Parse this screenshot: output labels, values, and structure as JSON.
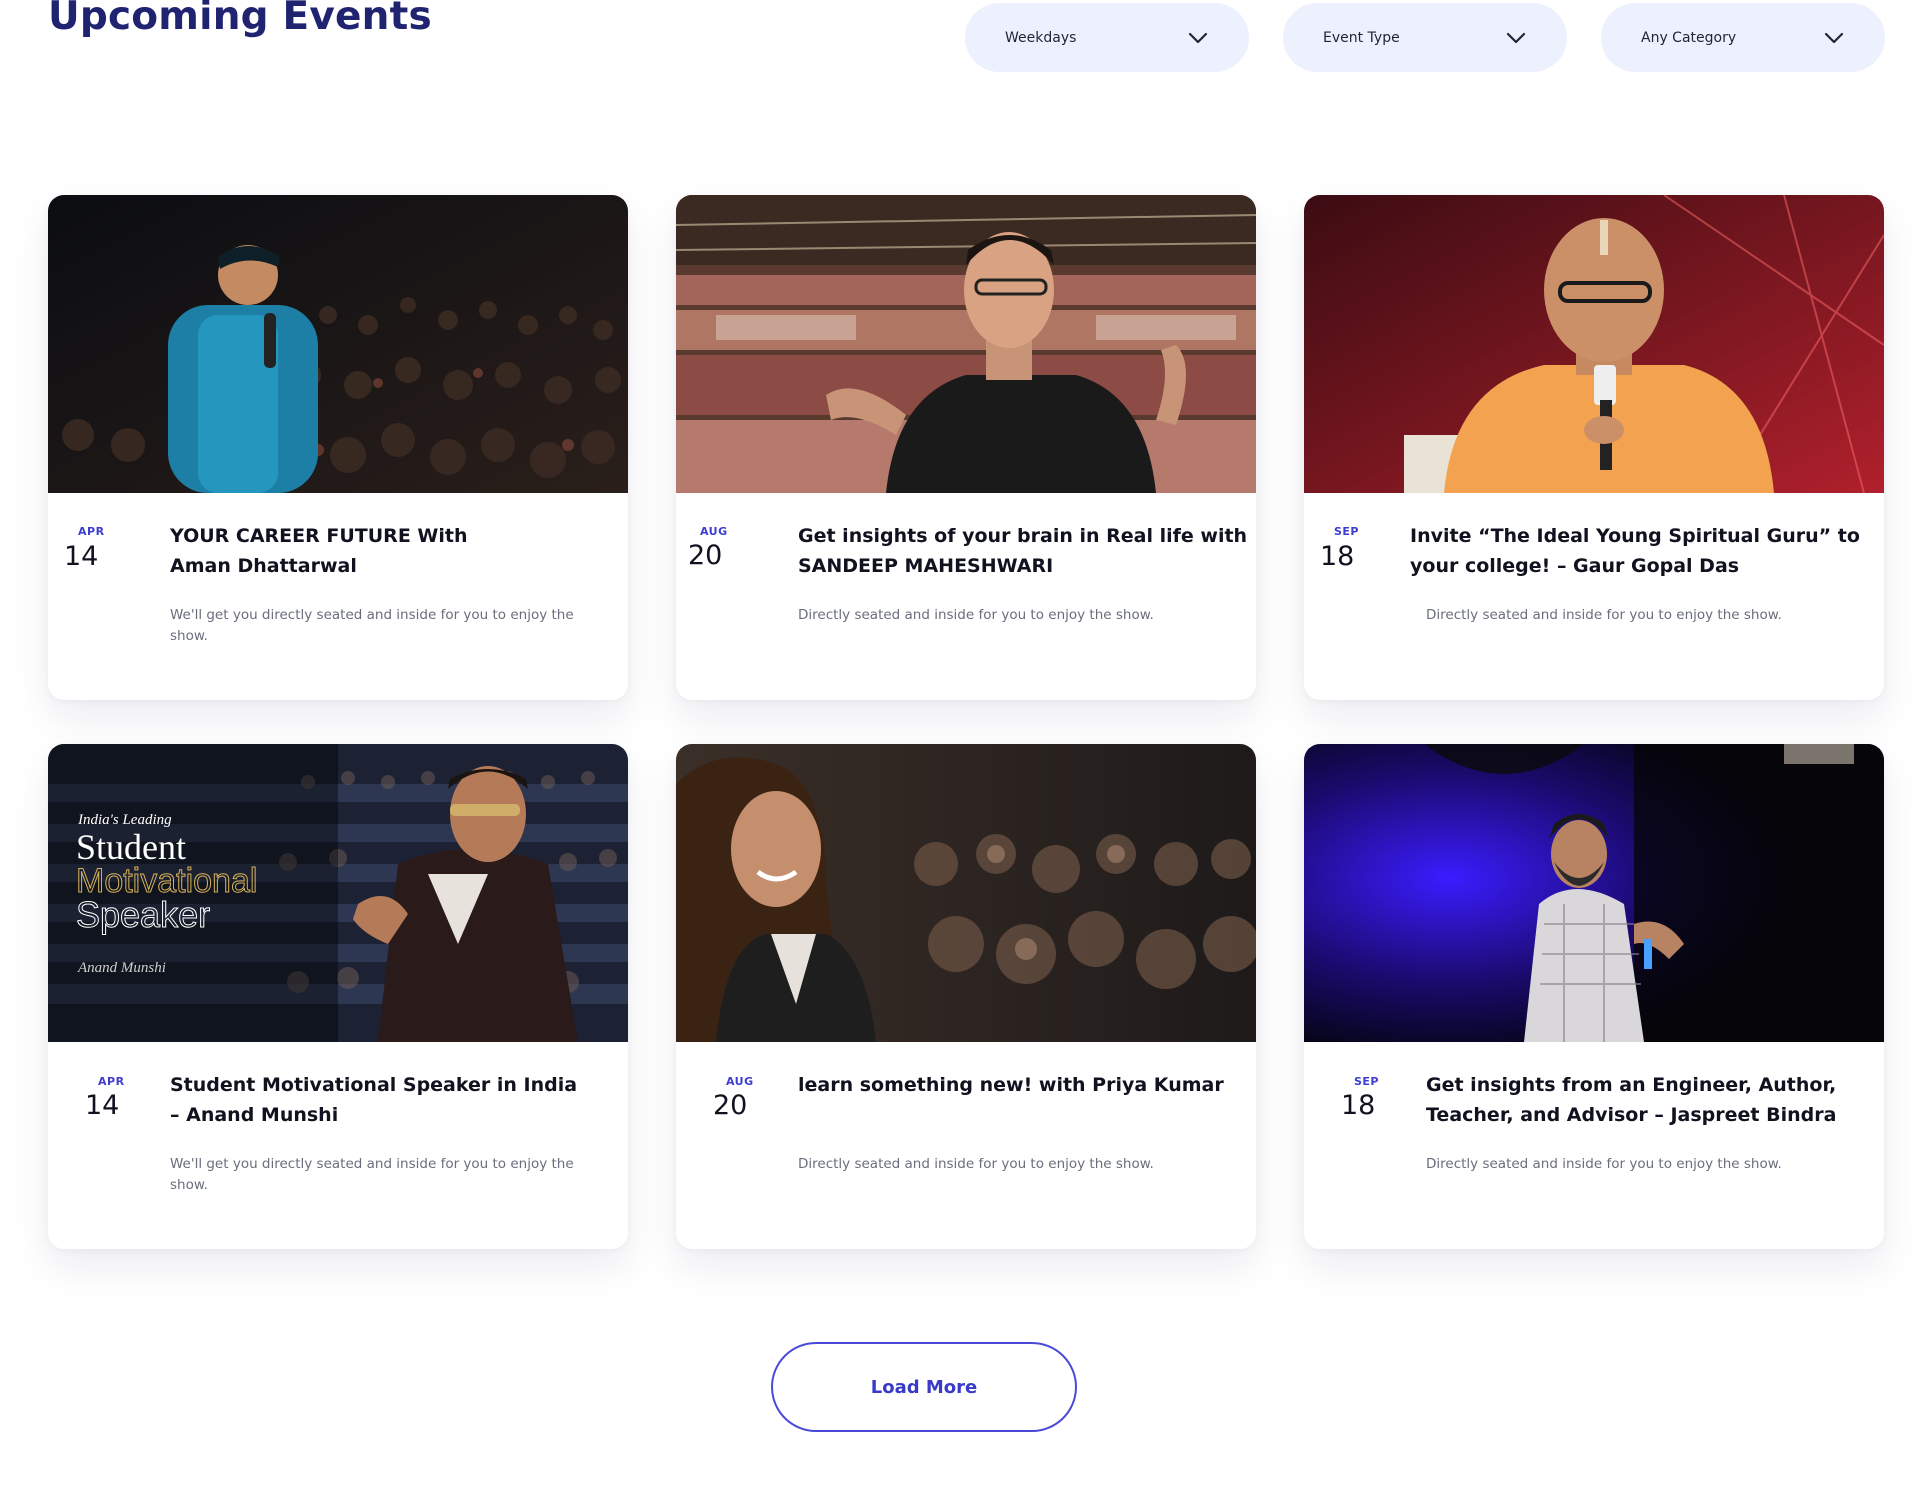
{
  "header": {
    "title": "Upcoming Events"
  },
  "filters": [
    {
      "label": "Weekdays",
      "icon": "chevron-down-icon"
    },
    {
      "label": "Event Type",
      "icon": "chevron-down-icon"
    },
    {
      "label": "Any Category",
      "icon": "chevron-down-icon"
    }
  ],
  "events": [
    {
      "month": "APR",
      "day": "14",
      "title_lines": [
        "YOUR CAREER FUTURE With",
        "Aman Dhattarwal"
      ],
      "desc_lines": [
        "We'll get you directly seated and inside for you to enjoy the",
        "show."
      ]
    },
    {
      "month": "AUG",
      "day": "20",
      "title_lines": [
        "Get insights of your brain in Real life with",
        "SANDEEP MAHESHWARI"
      ],
      "desc_lines": [
        "Directly seated and inside for you to enjoy the show."
      ]
    },
    {
      "month": "SEP",
      "day": "18",
      "title_lines": [
        "Invite “The Ideal Young Spiritual Guru” to",
        "your college! – Gaur Gopal Das"
      ],
      "desc_lines": [
        "Directly seated and inside for you to enjoy the show."
      ]
    },
    {
      "month": "APR",
      "day": "14",
      "title_lines": [
        "Student Motivational Speaker in India",
        "– Anand Munshi"
      ],
      "desc_lines": [
        "We'll get you directly seated and inside for you to enjoy the",
        "show."
      ]
    },
    {
      "month": "AUG",
      "day": "20",
      "title_lines": [
        "learn something new! with Priya Kumar"
      ],
      "desc_lines": [
        "Directly seated and inside for you to enjoy the show."
      ]
    },
    {
      "month": "SEP",
      "day": "18",
      "title_lines": [
        "Get insights from an Engineer, Author,",
        "Teacher, and Advisor – Jaspreet Bindra"
      ],
      "desc_lines": [
        "Directly seated and inside for you to enjoy the show."
      ]
    }
  ],
  "poster": {
    "tagline": "India's Leading",
    "word1": "Student",
    "word2": "Motivational",
    "word3": "Speaker",
    "signature": "Anand Munshi"
  },
  "load_more": {
    "label": "Load More"
  },
  "colors": {
    "accent": "#3a3ac9",
    "heading": "#1f2370",
    "filter_bg": "#edf0fd"
  }
}
